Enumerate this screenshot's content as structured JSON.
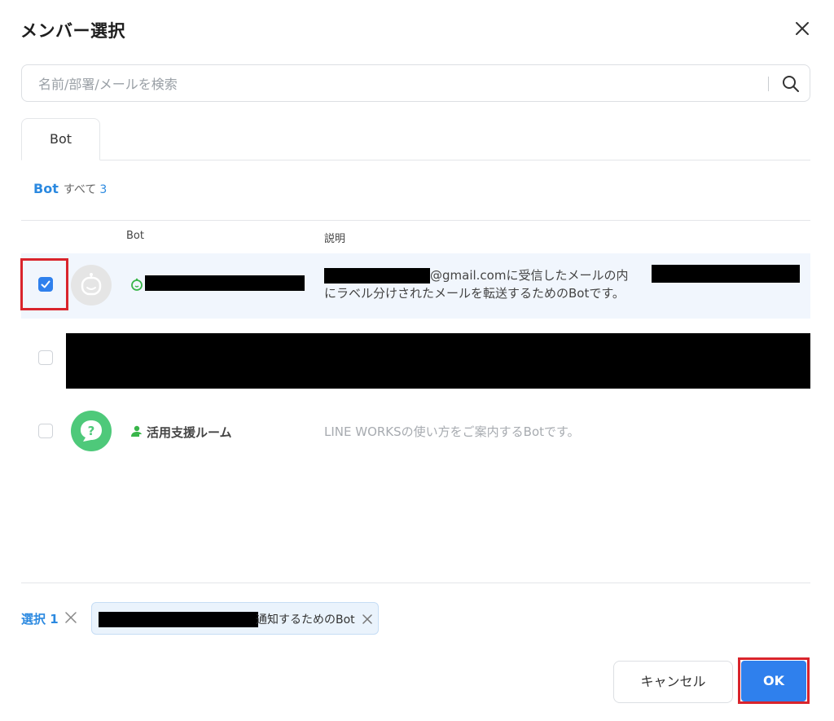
{
  "dialog": {
    "title": "メンバー選択"
  },
  "search": {
    "placeholder": "名前/部署/メールを検索"
  },
  "tabs": [
    {
      "label": "Bot"
    }
  ],
  "filter": {
    "category": "Bot",
    "all_label": "すべて",
    "count": "3"
  },
  "table": {
    "headers": {
      "bot": "Bot",
      "description": "説明"
    },
    "rows": [
      {
        "checked": true,
        "name": "",
        "description_line1": "@gmail.comに受信したメールの内",
        "description_line2": "にラベル分けされたメールを転送するためのBotです。"
      },
      {
        "checked": false,
        "name": "",
        "description": ""
      },
      {
        "checked": false,
        "name": "活用支援ルーム",
        "description": "LINE WORKSの使い方をご案内するBotです。",
        "avatar_glyph": "?"
      }
    ]
  },
  "selection": {
    "label": "選択",
    "count": "1",
    "chip_text": "通知するためのBot"
  },
  "buttons": {
    "cancel": "キャンセル",
    "ok": "OK"
  },
  "colors": {
    "accent": "#2f80ed",
    "link": "#2b89e0",
    "highlight": "#d9242c",
    "selected_row": "#f1f6fd"
  }
}
